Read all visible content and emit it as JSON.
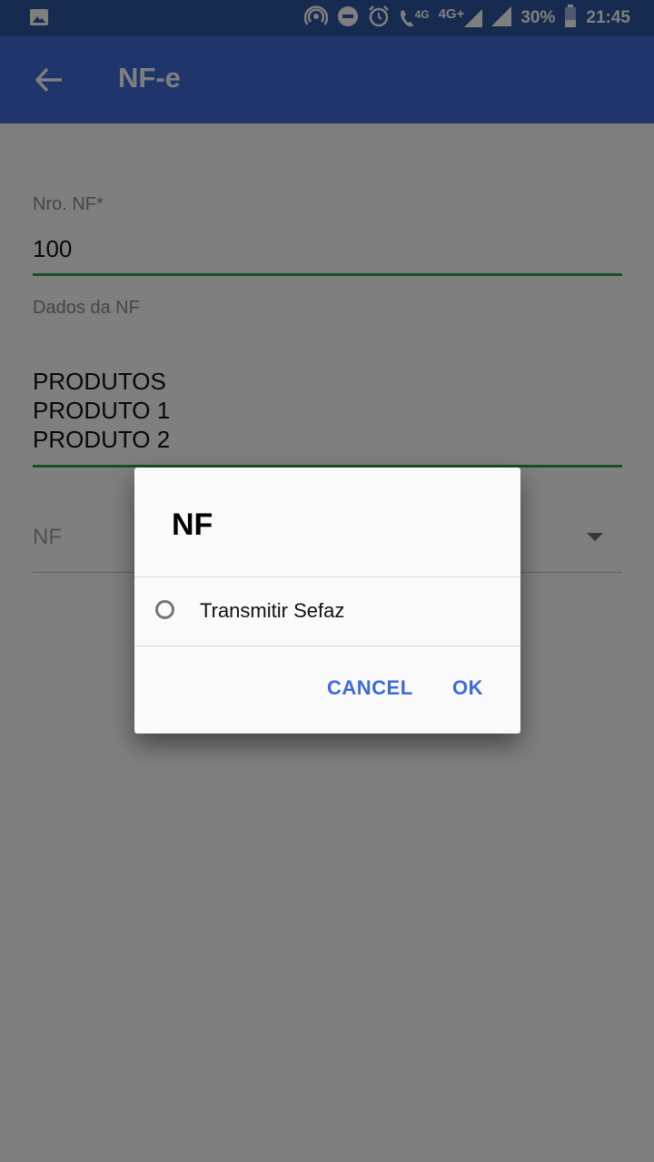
{
  "status_bar": {
    "icons": [
      "image-icon",
      "hotspot-icon",
      "do-not-disturb-icon",
      "alarm-icon",
      "volte-call-icon",
      "signal-4g-plus-icon",
      "signal-icon",
      "battery-icon"
    ],
    "call_tag": "4G",
    "network_label": "4G+",
    "battery": "30%",
    "time": "21:45"
  },
  "app_bar": {
    "title": "NF-e",
    "color": "#3f6ad8"
  },
  "form": {
    "nro_nf_label": "Nro. NF*",
    "nro_nf_value": "100",
    "dados_label": "Dados da NF",
    "dados_lines": [
      "PRODUTOS",
      "PRODUTO 1",
      "PRODUTO 2"
    ],
    "select_placeholder": "NF"
  },
  "dialog": {
    "title": "NF",
    "options": [
      {
        "label": "Transmitir Sefaz",
        "selected": false
      }
    ],
    "cancel_label": "CANCEL",
    "ok_label": "OK",
    "accent_color": "#3f6ad8"
  }
}
